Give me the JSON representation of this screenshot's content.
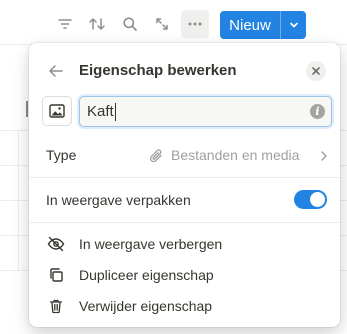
{
  "toolbar": {
    "icons": [
      "filter-icon",
      "sort-icon",
      "search-icon",
      "expand-icon",
      "more-icon"
    ],
    "new_label": "Nieuw",
    "accent": "#2383e2"
  },
  "background": {
    "column_glyph": "I"
  },
  "panel": {
    "title": "Eigenschap bewerken",
    "name_value": "Kaft",
    "type_label": "Type",
    "type_value": "Bestanden en media",
    "wrap_label": "In weergave verpakken",
    "wrap_on": true,
    "actions": [
      {
        "icon": "eye-off-icon",
        "label": "In weergave verbergen"
      },
      {
        "icon": "duplicate-icon",
        "label": "Dupliceer eigenschap"
      },
      {
        "icon": "trash-icon",
        "label": "Verwijder eigenschap"
      }
    ]
  }
}
